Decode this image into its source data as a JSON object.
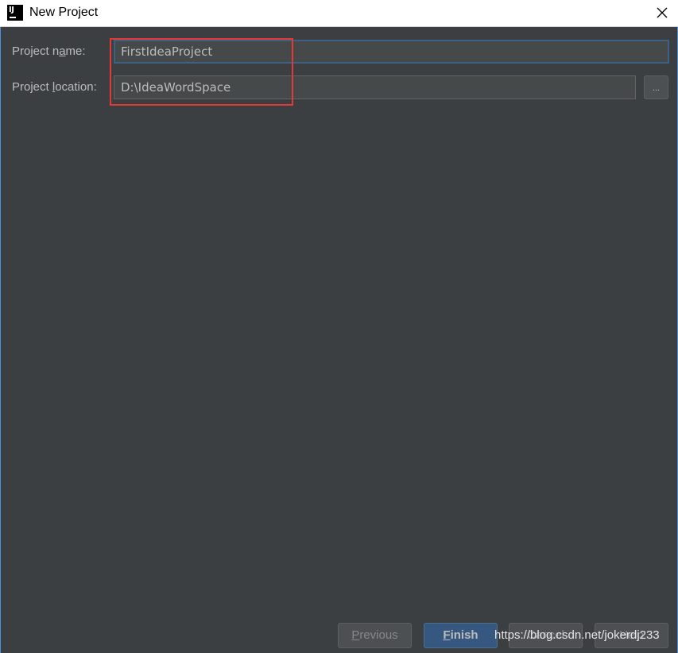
{
  "window": {
    "title": "New Project",
    "icon": "intellij-idea-icon",
    "icon_text": "IJ"
  },
  "form": {
    "name_label_prefix": "Project n",
    "name_label_mnemonic": "a",
    "name_label_suffix": "me:",
    "name_value": "FirstIdeaProject",
    "location_label_prefix": "Project ",
    "location_label_mnemonic": "l",
    "location_label_suffix": "ocation:",
    "location_value": "D:\\IdeaWordSpace",
    "browse_label": "..."
  },
  "buttons": {
    "previous_mnemonic": "P",
    "previous_rest": "revious",
    "finish_mnemonic": "F",
    "finish_rest": "inish",
    "cancel_label": "Cancel",
    "help_label": "Help"
  },
  "watermark": "https://blog.csdn.net/jokerdj233",
  "colors": {
    "background": "#3c3f41",
    "field_background": "#45494a",
    "focus_border": "#3d6185",
    "default_button": "#365880",
    "highlight": "#e53935"
  }
}
